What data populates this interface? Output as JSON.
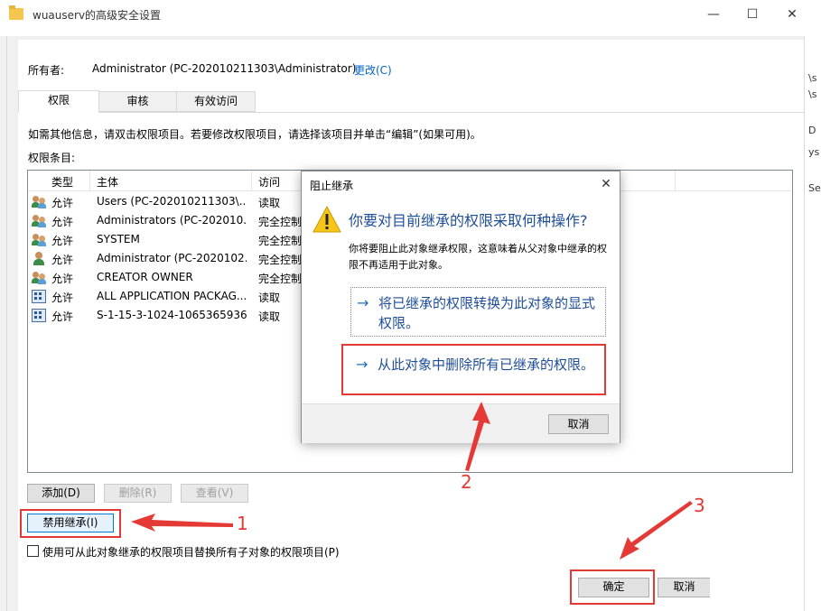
{
  "window": {
    "title": "wuauserv的高级安全设置",
    "minimize": "—",
    "maximize": "☐",
    "close": "✕"
  },
  "owner": {
    "label": "所有者:",
    "value": "Administrator (PC-202010211303\\Administrator)",
    "change_link": "更改(C)"
  },
  "tabs": [
    {
      "label": "权限"
    },
    {
      "label": "审核"
    },
    {
      "label": "有效访问"
    }
  ],
  "info_text": "如需其他信息，请双击权限项目。若要修改权限项目，请选择该项目并单击“编辑”(如果可用)。",
  "entries_label": "权限条目:",
  "table": {
    "headers": [
      "类型",
      "主体",
      "访问"
    ],
    "rows": [
      {
        "icon": "users-icon",
        "type": "允许",
        "principal": "Users (PC-202010211303\\...",
        "access": "读取"
      },
      {
        "icon": "users-icon",
        "type": "允许",
        "principal": "Administrators (PC-202010...",
        "access": "完全控制"
      },
      {
        "icon": "users-icon",
        "type": "允许",
        "principal": "SYSTEM",
        "access": "完全控制"
      },
      {
        "icon": "user-icon",
        "type": "允许",
        "principal": "Administrator (PC-2020102...",
        "access": "完全控制"
      },
      {
        "icon": "users-icon",
        "type": "允许",
        "principal": "CREATOR OWNER",
        "access": "完全控制"
      },
      {
        "icon": "app-package-icon",
        "type": "允许",
        "principal": "ALL APPLICATION PACKAG...",
        "access": "读取"
      },
      {
        "icon": "app-package-icon",
        "type": "允许",
        "principal": "S-1-15-3-1024-1065365936...",
        "access": "读取"
      }
    ]
  },
  "buttons": {
    "add": "添加(D)",
    "remove": "删除(R)",
    "view": "查看(V)",
    "disable_inheritance": "禁用继承(I)",
    "ok": "确定",
    "cancel": "取消"
  },
  "checkbox_label": "使用可从此对象继承的权限项目替换所有子对象的权限项目(P)",
  "dialog": {
    "title": "阻止继承",
    "close": "✕",
    "question": "你要对目前继承的权限采取何种操作?",
    "description": "你将要阻止此对象继承权限，这意味着从父对象中继承的权限不再适用于此对象。",
    "option_convert": "将已继承的权限转换为此对象的显式权限。",
    "option_remove": "从此对象中删除所有已继承的权限。",
    "arrow": "→",
    "cancel": "取消"
  },
  "annotations": {
    "step1": "1",
    "step2": "2",
    "step3": "3",
    "color": "#e53935"
  },
  "background_fragments": [
    "\\s",
    "\\s",
    "D",
    "ys",
    "Se"
  ]
}
